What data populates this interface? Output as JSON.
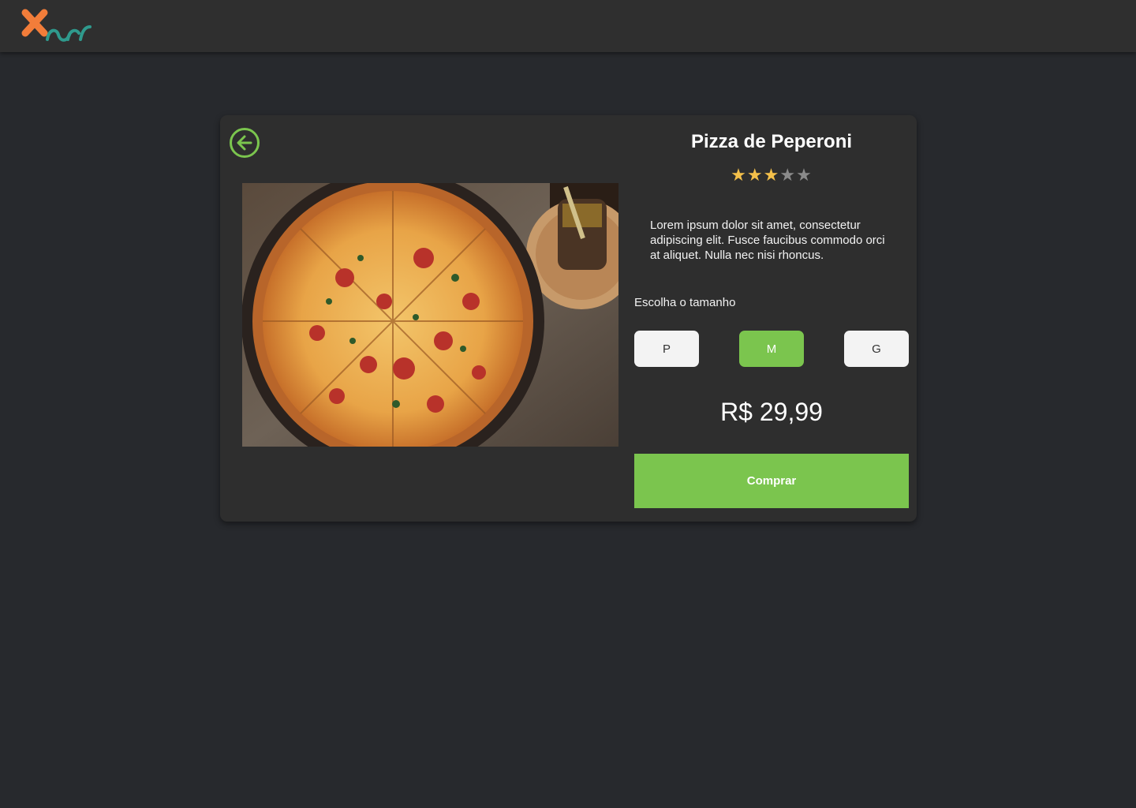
{
  "header": {
    "logo_icon": "brand-logo-icon",
    "logo_colors": {
      "primary": "#f27d3a",
      "secondary": "#2f9a8d"
    }
  },
  "product": {
    "back_icon": "arrow-left-circle-icon",
    "title": "Pizza de Peperoni",
    "rating": {
      "value": 3,
      "max": 5
    },
    "image_icon": "pepperoni-pizza-photo",
    "description": "Lorem ipsum dolor sit amet, consectetur adipiscing elit. Fusce faucibus commodo orci at aliquet. Nulla nec nisi rhoncus.",
    "size_label": "Escolha o tamanho",
    "sizes": [
      {
        "label": "P",
        "selected": false
      },
      {
        "label": "M",
        "selected": true
      },
      {
        "label": "G",
        "selected": false
      }
    ],
    "price": "R$ 29,99",
    "buy_label": "Comprar"
  },
  "colors": {
    "background": "#27292d",
    "topbar": "#2f2f2f",
    "card": "#2e2e2e",
    "accent": "#7bc54e",
    "star_on": "#f4c04a",
    "star_off": "#8a8a8a"
  }
}
